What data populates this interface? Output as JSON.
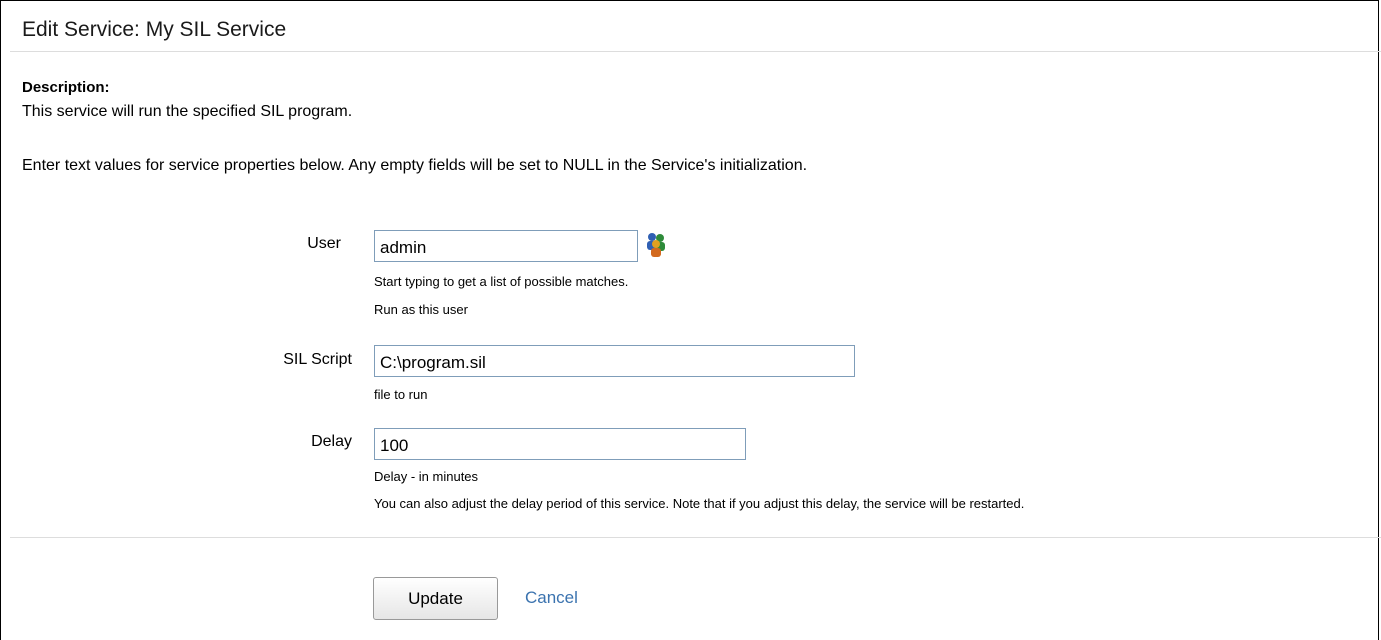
{
  "page": {
    "title": "Edit Service: My SIL Service"
  },
  "description": {
    "label": "Description:",
    "text": "This service will run the specified SIL program.",
    "intro": "Enter text values for service properties below. Any empty fields will be set to NULL in the Service's initialization."
  },
  "fields": {
    "user": {
      "label": "User",
      "value": "admin",
      "hint1": "Start typing to get a list of possible matches.",
      "hint2": "Run as this user",
      "picker_icon": "user-picker-icon"
    },
    "sil_script": {
      "label": "SIL Script",
      "value": "C:\\program.sil",
      "hint1": "file to run"
    },
    "delay": {
      "label": "Delay",
      "value": "100",
      "hint1": "Delay - in minutes",
      "hint2": "You can also adjust the delay period of this service. Note that if you adjust this delay, the service will be restarted."
    }
  },
  "actions": {
    "update_label": "Update",
    "cancel_label": "Cancel"
  },
  "colors": {
    "link": "#3b73af",
    "input_border": "#7f9db9",
    "rule": "#dddddd"
  }
}
